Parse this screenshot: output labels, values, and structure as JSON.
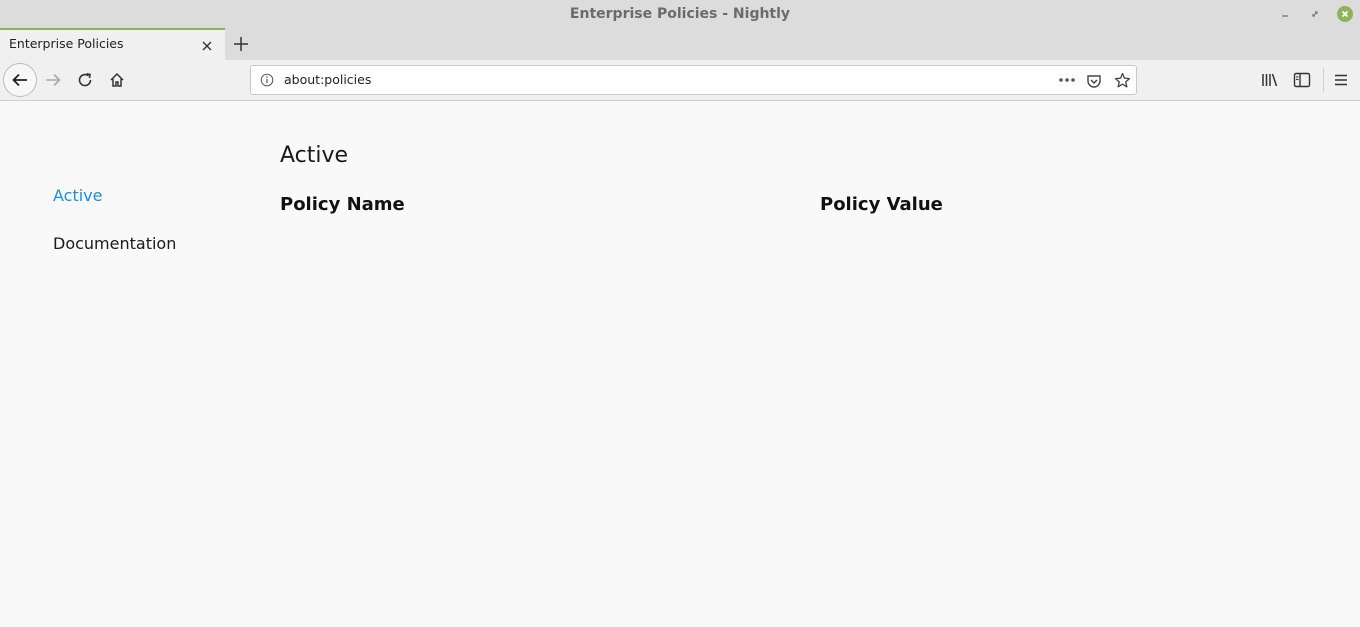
{
  "window": {
    "title": "Enterprise Policies - Nightly"
  },
  "tabs": [
    {
      "label": "Enterprise Policies",
      "active": true
    }
  ],
  "urlbar": {
    "url": "about:policies"
  },
  "sidebar": {
    "items": [
      {
        "label": "Active",
        "selected": true
      },
      {
        "label": "Documentation",
        "selected": false
      }
    ]
  },
  "main": {
    "section_title": "Active",
    "columns": [
      "Policy Name",
      "Policy Value"
    ]
  },
  "colors": {
    "accent": "#8fb25a",
    "link_active": "#1a8ee0"
  }
}
